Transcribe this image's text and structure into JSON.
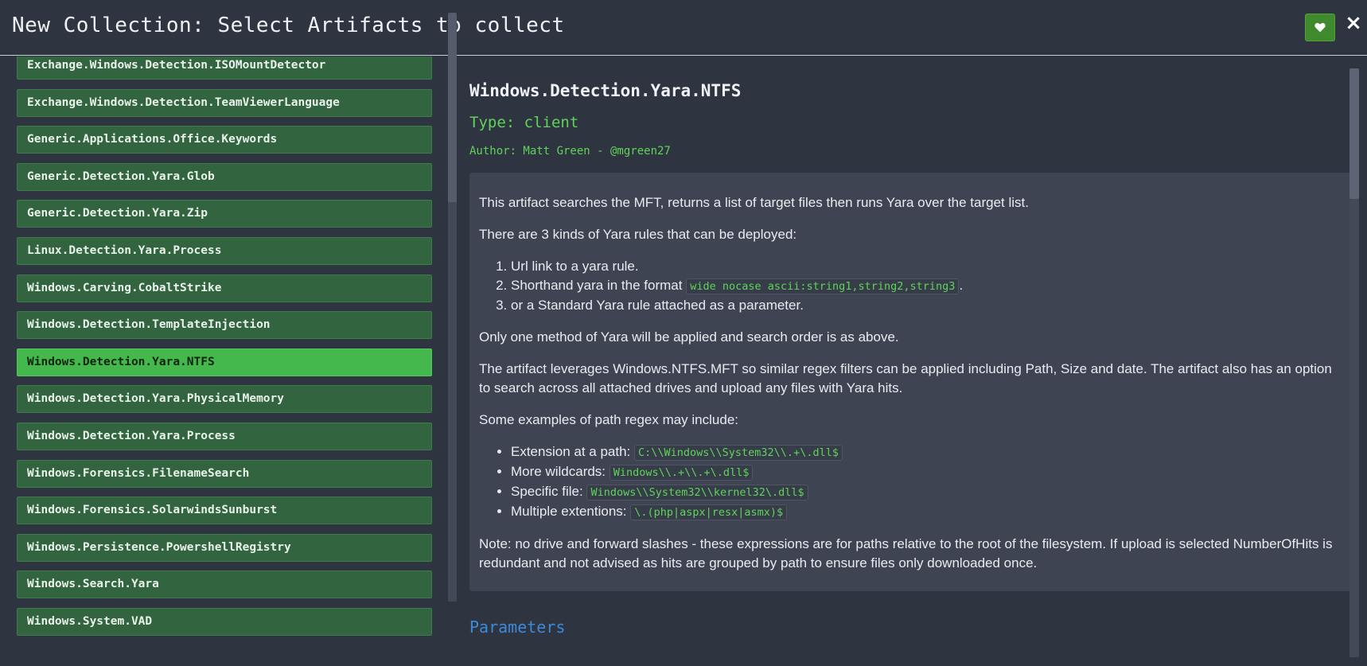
{
  "header": {
    "title": "New Collection: Select Artifacts to collect",
    "close_label": "×"
  },
  "artifacts": [
    {
      "label": "Exchange.Windows.Detection.ISOMountDetector"
    },
    {
      "label": "Exchange.Windows.Detection.TeamViewerLanguage"
    },
    {
      "label": "Generic.Applications.Office.Keywords"
    },
    {
      "label": "Generic.Detection.Yara.Glob"
    },
    {
      "label": "Generic.Detection.Yara.Zip"
    },
    {
      "label": "Linux.Detection.Yara.Process"
    },
    {
      "label": "Windows.Carving.CobaltStrike"
    },
    {
      "label": "Windows.Detection.TemplateInjection"
    },
    {
      "label": "Windows.Detection.Yara.NTFS",
      "selected": true
    },
    {
      "label": "Windows.Detection.Yara.PhysicalMemory"
    },
    {
      "label": "Windows.Detection.Yara.Process"
    },
    {
      "label": "Windows.Forensics.FilenameSearch"
    },
    {
      "label": "Windows.Forensics.SolarwindsSunburst"
    },
    {
      "label": "Windows.Persistence.PowershellRegistry"
    },
    {
      "label": "Windows.Search.Yara"
    },
    {
      "label": "Windows.System.VAD"
    }
  ],
  "detail": {
    "name": "Windows.Detection.Yara.NTFS",
    "type": "Type: client",
    "author": "Author: Matt Green - @mgreen27",
    "intro": "This artifact searches the MFT, returns a list of target files then runs Yara over the target list.",
    "kinds_intro": "There are 3 kinds of Yara rules that can be deployed:",
    "kinds": [
      "Url link to a yara rule.",
      "Shorthand yara in the format ",
      "or a Standard Yara rule attached as a parameter."
    ],
    "shorthand_code": "wide nocase ascii:string1,string2,string3",
    "order": "Only one method of Yara will be applied and search order is as above.",
    "leverage": "The artifact leverages Windows.NTFS.MFT so similar regex filters can be applied including Path, Size and date. The artifact also has an option to search across all attached drives and upload any files with Yara hits.",
    "examples_intro": "Some examples of path regex may include:",
    "examples": [
      {
        "label": "Extension at a path: ",
        "code": "C:\\\\Windows\\\\System32\\\\.+\\.dll$"
      },
      {
        "label": "More wildcards: ",
        "code": "Windows\\\\.+\\\\.+\\.dll$"
      },
      {
        "label": "Specific file: ",
        "code": "Windows\\\\System32\\\\kernel32\\.dll$"
      },
      {
        "label": "Multiple extentions: ",
        "code": "\\.(php|aspx|resx|asmx)$"
      }
    ],
    "note": "Note: no drive and forward slashes - these expressions are for paths relative to the root of the filesystem. If upload is selected NumberOfHits is redundant and not advised as hits are grouped by path to ensure files only downloaded once.",
    "params_title": "Parameters"
  },
  "colors": {
    "accent_green": "#5fd35a",
    "selected_item": "#44b84c",
    "list_item": "#336440",
    "params_blue": "#3d8ad9"
  },
  "icons": {
    "favorite": "heart-icon",
    "close": "close-icon"
  }
}
